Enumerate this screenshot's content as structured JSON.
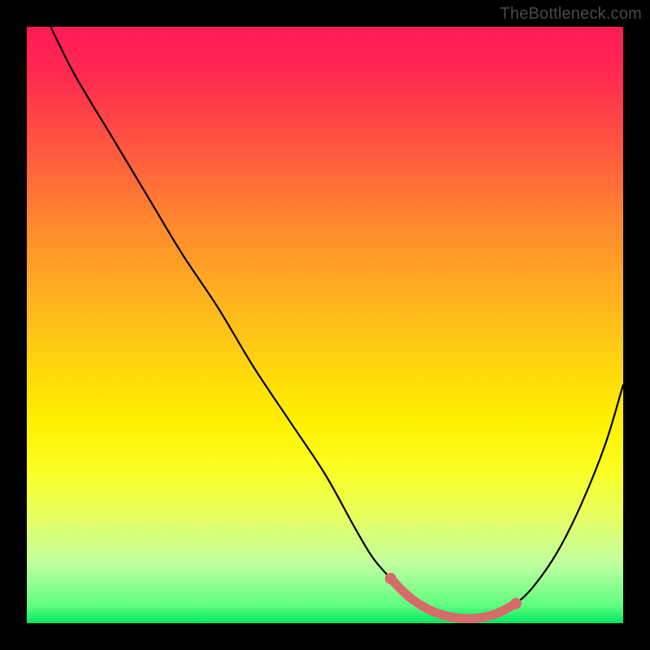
{
  "watermark": "TheBottleneck.com",
  "colors": {
    "curve_stroke": "#000000",
    "highlight_stroke": "#d76a6a",
    "gradient_top": "#ff1a55",
    "gradient_bottom": "#00e860",
    "frame": "#000000"
  },
  "chart_data": {
    "type": "line",
    "title": "",
    "xlabel": "",
    "ylabel": "",
    "xlim": [
      0,
      100
    ],
    "ylim": [
      0,
      100
    ],
    "axes_visible": false,
    "series": [
      {
        "name": "bottleneck_curve",
        "x": [
          4,
          8,
          14,
          20,
          26,
          32,
          38,
          44,
          50,
          55,
          58,
          61,
          64,
          67,
          70,
          73,
          76,
          79,
          82,
          85,
          89,
          93,
          97,
          100
        ],
        "y": [
          100,
          92,
          82,
          72,
          62,
          53,
          43,
          34,
          25,
          16,
          11,
          7.5,
          4.5,
          2.5,
          1.3,
          0.8,
          0.9,
          1.7,
          3.3,
          6.2,
          12,
          20,
          30,
          40
        ]
      }
    ],
    "highlight_range_x": [
      61,
      82
    ]
  }
}
